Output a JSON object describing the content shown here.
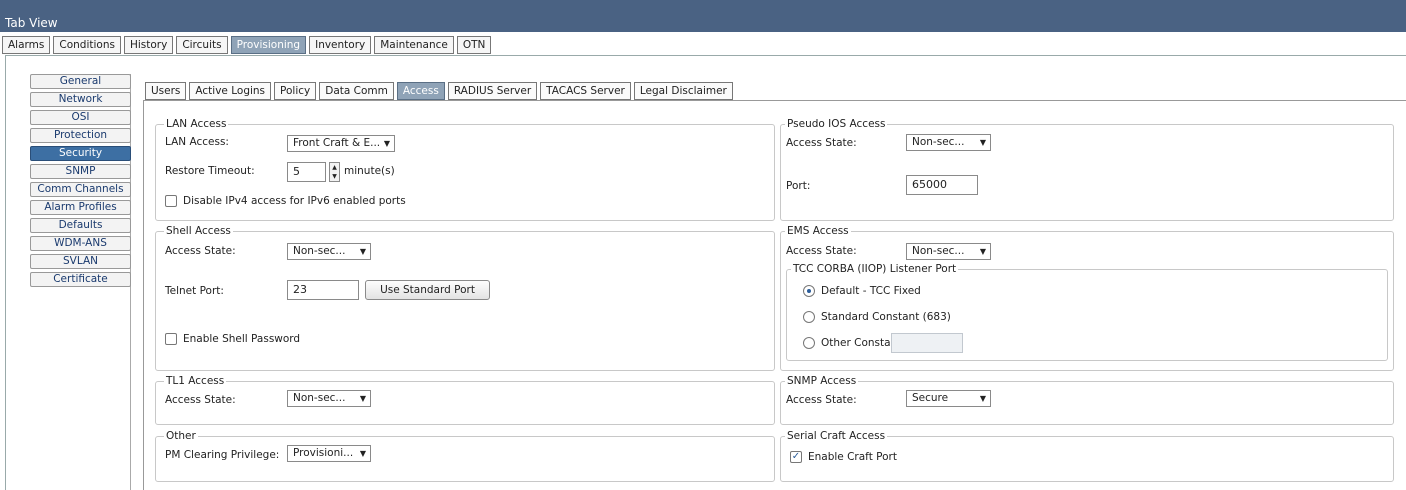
{
  "window": {
    "title": "Tab View"
  },
  "main_tabs": [
    "Alarms",
    "Conditions",
    "History",
    "Circuits",
    "Provisioning",
    "Inventory",
    "Maintenance",
    "OTN"
  ],
  "side_nav": [
    "General",
    "Network",
    "OSI",
    "Protection",
    "Security",
    "SNMP",
    "Comm Channels",
    "Alarm Profiles",
    "Defaults",
    "WDM-ANS",
    "SVLAN",
    "Certificate"
  ],
  "sub_tabs": [
    "Users",
    "Active Logins",
    "Policy",
    "Data Comm",
    "Access",
    "RADIUS Server",
    "TACACS Server",
    "Legal Disclaimer"
  ],
  "lan": {
    "title": "LAN Access",
    "access_label": "LAN Access:",
    "access_value": "Front Craft & E...",
    "restore_label": "Restore Timeout:",
    "restore_value": "5",
    "restore_unit": "minute(s)",
    "disable_ipv4_label": "Disable IPv4 access for IPv6 enabled ports"
  },
  "shell": {
    "title": "Shell Access",
    "state_label": "Access State:",
    "state_value": "Non-sec...",
    "telnet_label": "Telnet Port:",
    "telnet_value": "23",
    "use_standard_label": "Use Standard Port",
    "enable_pw_label": "Enable Shell Password"
  },
  "tl1": {
    "title": "TL1 Access",
    "state_label": "Access State:",
    "state_value": "Non-sec..."
  },
  "other": {
    "title": "Other",
    "pm_label": "PM Clearing Privilege:",
    "pm_value": "Provisioni..."
  },
  "pseudo_ios": {
    "title": "Pseudo IOS Access",
    "state_label": "Access State:",
    "state_value": "Non-sec...",
    "port_label": "Port:",
    "port_value": "65000"
  },
  "ems": {
    "title": "EMS Access",
    "state_label": "Access State:",
    "state_value": "Non-sec...",
    "corba_title": "TCC CORBA (IIOP) Listener Port",
    "opt_default": "Default - TCC Fixed",
    "opt_standard": "Standard Constant (683)",
    "opt_other": "Other Constant:"
  },
  "snmp": {
    "title": "SNMP Access",
    "state_label": "Access State:",
    "state_value": "Secure"
  },
  "serial": {
    "title": "Serial Craft Access",
    "enable_label": "Enable Craft Port"
  }
}
